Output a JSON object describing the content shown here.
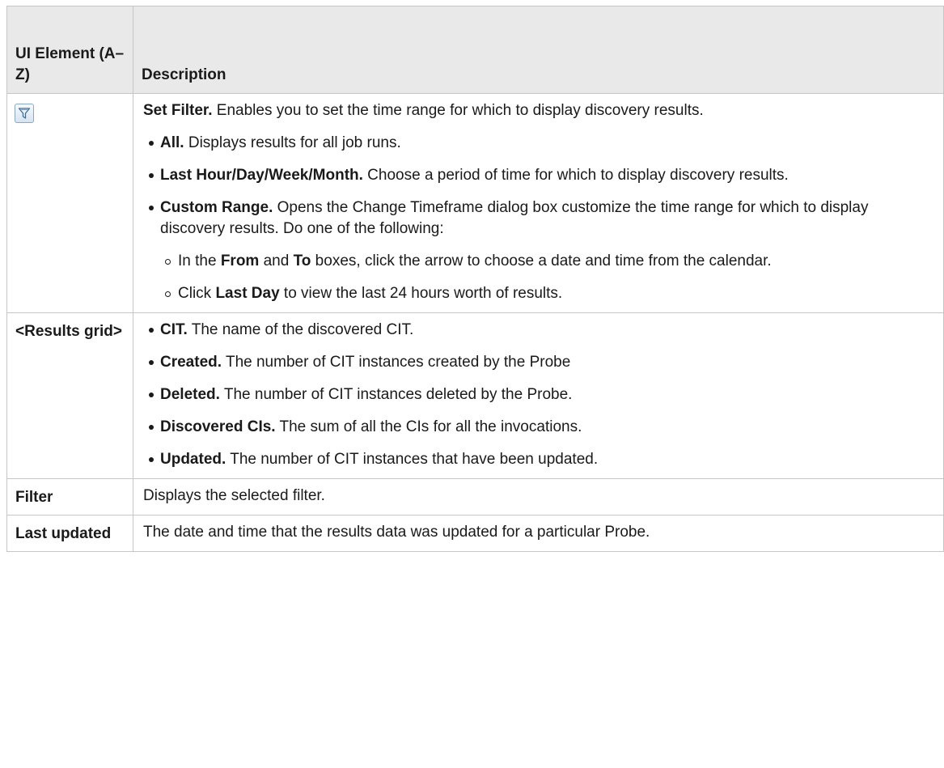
{
  "headers": {
    "element": "UI Element (A–Z)",
    "description": "Description"
  },
  "rows": [
    {
      "icon": "filter-icon",
      "title": "Set Filter.",
      "text": " Enables you to set the time range for which to display discovery results.",
      "bullets": [
        {
          "bold": "All.",
          "text": " Displays results for all job runs."
        },
        {
          "bold": "Last Hour/Day/Week/Month.",
          "text": " Choose a period of time for which to display discovery results."
        },
        {
          "bold": "Custom Range.",
          "text": " Opens the Change Timeframe dialog box customize the time range for which to display discovery results. Do one of the following:",
          "sub": [
            {
              "p1": "In the ",
              "b1": "From",
              "p2": " and ",
              "b2": "To",
              "p3": " boxes, click the arrow to choose a date and time from the calendar."
            },
            {
              "p1": "Click ",
              "b1": "Last Day",
              "p2": " to view the last 24 hours worth of results."
            }
          ]
        }
      ]
    },
    {
      "label": "<Results grid>",
      "bullets": [
        {
          "bold": "CIT.",
          "text": " The name of the discovered CIT."
        },
        {
          "bold": "Created.",
          "text": " The number of CIT instances created by the Probe"
        },
        {
          "bold": "Deleted.",
          "text": " The number of CIT instances deleted by the Probe."
        },
        {
          "bold": "Discovered CIs.",
          "text": " The sum of all the CIs for all the invocations."
        },
        {
          "bold": "Updated.",
          "text": " The number of CIT instances that have been updated."
        }
      ]
    },
    {
      "label": "Filter",
      "text": "Displays the selected filter."
    },
    {
      "label": "Last updated",
      "text": "The date and time that the results data was updated for a particular Probe."
    }
  ]
}
